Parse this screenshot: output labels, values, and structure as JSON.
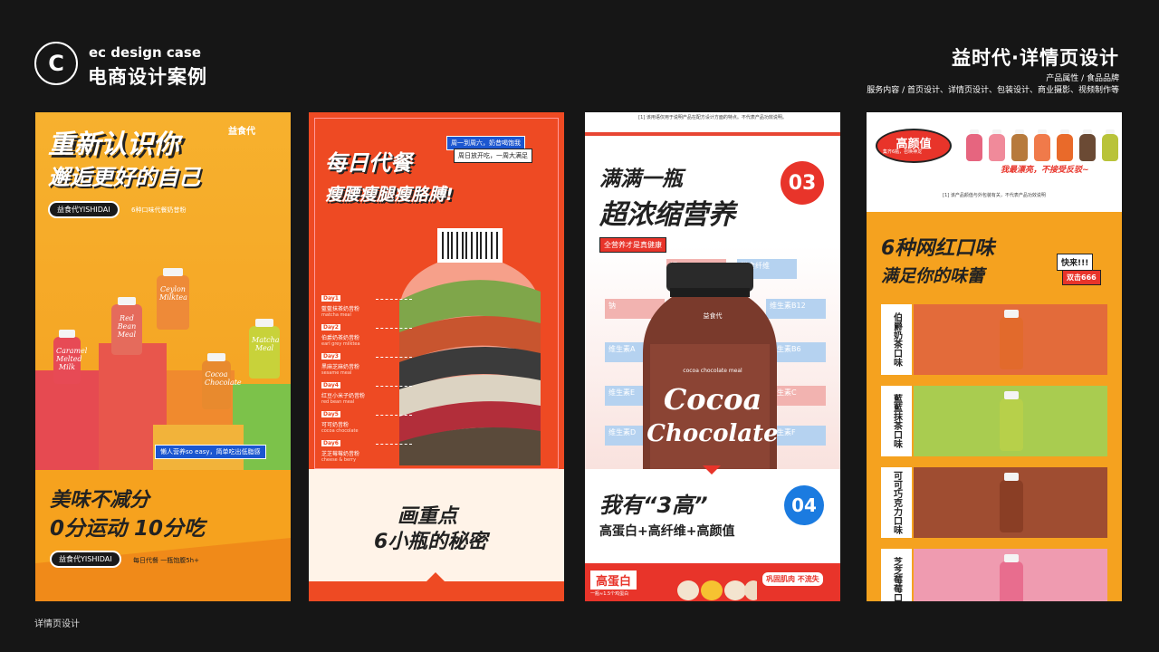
{
  "header": {
    "logo_glyph": "C",
    "logo_en": "ec design case",
    "logo_cn": "电商设计案例",
    "title": "益时代·详情页设计",
    "sub1": "产品属性 / 食品品牌",
    "sub2": "服务内容 / 首页设计、详情页设计、包装设计、商业摄影、视频制作等"
  },
  "footer": "详情页设计",
  "panel1": {
    "title1": "重新认识你",
    "title2": "邂逅更好的自己",
    "brand": "益食代",
    "pill": "益食代YISHIDAI",
    "pill_caption": "6种口味代餐奶昔粉",
    "tag": "懒人营养so easy，简单吃出低脂感",
    "slogan1": "美味不减分",
    "slogan2": "0分运动 10分吃",
    "pill2": "益食代YISHIDAI",
    "pill2_caption": "每日代餐 一瓶饱腹5h+",
    "bottles": [
      {
        "label": "Caramel Melted Milk",
        "color": "#e74a55"
      },
      {
        "label": "Red Bean Meal",
        "color": "#e56b5c"
      },
      {
        "label": "Ceylon Milktea",
        "color": "#ee8a38"
      },
      {
        "label": "Cocoa Chocolate",
        "color": "#e88a2e"
      },
      {
        "label": "Matcha Meal",
        "color": "#c8d23a"
      }
    ]
  },
  "panel2": {
    "title1": "每日代餐",
    "title2": "瘦腰瘦腿瘦胳膊!",
    "note1": "周一到周六，奶昔喝饱我",
    "note2": "周日放开吃，一周大满足",
    "days": [
      {
        "tag": "Day1",
        "name": "藍藍抹茶奶昔粉",
        "en": "matcha meal"
      },
      {
        "tag": "Day2",
        "name": "伯爵奶茶奶昔粉",
        "en": "earl grey milktea"
      },
      {
        "tag": "Day3",
        "name": "黑麻芝麻奶昔粉",
        "en": "sesame meal"
      },
      {
        "tag": "Day4",
        "name": "红豆小米子奶昔粉",
        "en": "red bean meal"
      },
      {
        "tag": "Day5",
        "name": "可可奶昔粉",
        "en": "cocoa chocolate"
      },
      {
        "tag": "Day6",
        "name": "芝芝莓莓奶昔粉",
        "en": "cheese & berry"
      }
    ],
    "cap1": "画重点",
    "cap2": "6小瓶的秘密"
  },
  "panel3": {
    "top_note": "[1] 该用语仅用于说明产品在配方设计方面的特点。不代表产品功效说明。",
    "title1": "满满一瓶",
    "title2": "超浓缩营养",
    "num1": "03",
    "tag": "全营养才是真健康",
    "nutrients": [
      "钙",
      "膳食纤维",
      "钠",
      "维生素B12",
      "维生素A",
      "维生素B6",
      "维生素E",
      "维生素C",
      "维生素D",
      "维生素F"
    ],
    "bottle_brand": "益食代",
    "bottle_sub": "cocoa chocolate meal",
    "bottle_l1": "Cocoa",
    "bottle_l2": "Chocolate",
    "num2": "04",
    "title3": "我有“3高”",
    "title4": "高蛋白+高纤维+高颜值",
    "badge1": "高蛋白",
    "badge1_sub": "一瓶≈1.5个鸡蛋白",
    "badge2": "巩固肌肉 不流失"
  },
  "panel4": {
    "hdr": "高颜值",
    "hdr_sub": "集齐6瓶，召唤神龙",
    "slogan": "我最漂亮，不接受反驳~",
    "top_note": "[1] 该产品颜值与外包装有关，不代表产品功效说明",
    "title1": "6种网红口味",
    "title2": "满足你的味蕾",
    "kl1": "快来!!!",
    "kl2": "双击666",
    "flavors": [
      {
        "label": "伯爵奶茶口味",
        "bg": "#e36b3a",
        "bottle": "#e26a2c"
      },
      {
        "label": "藍藍抹茶口味",
        "bg": "#a9cc50",
        "bottle": "#b7d04a"
      },
      {
        "label": "可可巧克力口味",
        "bg": "#9f4d31",
        "bottle": "#8a3e25"
      },
      {
        "label": "芝芝莓莓口味",
        "bg": "#ef9bb0",
        "bottle": "#e86d8e"
      }
    ],
    "swatches": [
      "#e6657f",
      "#f08a9a",
      "#b77a3c",
      "#f07a4a",
      "#e96a2a",
      "#6b4a34",
      "#b9c33a"
    ]
  }
}
